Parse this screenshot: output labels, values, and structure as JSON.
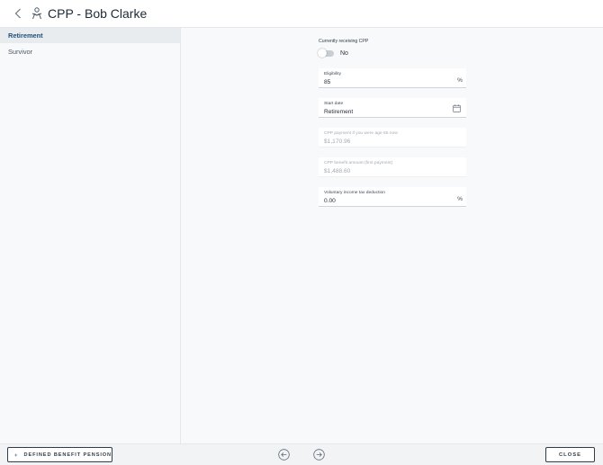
{
  "header": {
    "title": "CPP - Bob Clarke",
    "back_icon": "chevron-left-icon",
    "person_icon": "person-icon"
  },
  "sidebar": {
    "items": [
      {
        "label": "Retirement",
        "active": true
      },
      {
        "label": "Survivor",
        "active": false
      }
    ]
  },
  "form": {
    "receiving": {
      "label": "Currently receiving CPP",
      "value": "No",
      "on": false
    },
    "eligibility": {
      "label": "Eligibility",
      "value": "85",
      "suffix": "%"
    },
    "start_date": {
      "label": "Start date",
      "value": "Retirement",
      "icon": "calendar-icon"
    },
    "payment_at_65": {
      "label": "CPP payment if you were age 65 now",
      "value": "$1,170.96",
      "disabled": true
    },
    "benefit_amount": {
      "label": "CPP benefit amount (first payment)",
      "value": "$1,488.60",
      "disabled": true
    },
    "tax_deduction": {
      "label": "Voluntary income tax deduction",
      "value": "0.00",
      "suffix": "%"
    }
  },
  "footer": {
    "add_button_label": "DEFINED BENEFIT PENSION",
    "add_icon": "plus-icon",
    "prev_icon": "arrow-left-circle-icon",
    "next_icon": "arrow-right-circle-icon",
    "close_label": "CLOSE"
  },
  "colors": {
    "text": "#1e2a36",
    "accent": "#1f4e79",
    "disabled_text": "#a3abb3",
    "background": "#f8f9fa"
  }
}
